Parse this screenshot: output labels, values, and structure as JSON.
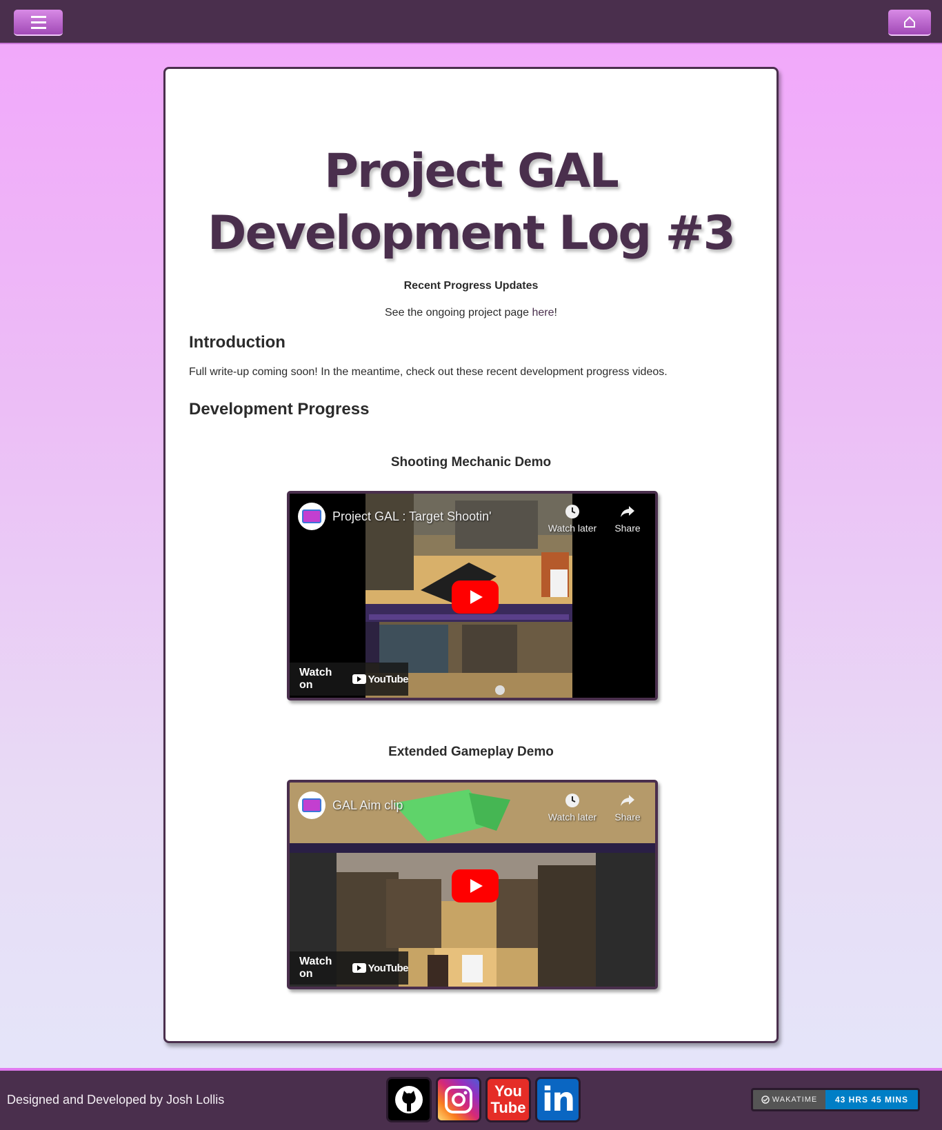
{
  "nav": {
    "menu_icon": "hamburger-menu-icon",
    "home_icon": "home-icon"
  },
  "article": {
    "title_line1": "Project GAL",
    "title_line2": "Development Log #3",
    "subtitle": "Recent Progress Updates",
    "project_link_prefix": "See the ongoing project page ",
    "project_link_text": "here",
    "project_link_suffix": "!",
    "intro_heading": "Introduction",
    "intro_text": "Full write-up coming soon! In the meantime, check out these recent development progress videos.",
    "dev_heading": "Development Progress"
  },
  "videos": [
    {
      "section_title": "Shooting Mechanic Demo",
      "video_title": "Project GAL : Target Shootin'",
      "watch_later": "Watch later",
      "share": "Share",
      "watch_on": "Watch on",
      "youtube": "YouTube"
    },
    {
      "section_title": "Extended Gameplay Demo",
      "video_title": "GAL Aim clip",
      "watch_later": "Watch later",
      "share": "Share",
      "watch_on": "Watch on",
      "youtube": "YouTube"
    }
  ],
  "footer": {
    "credits": "Designed and Developed by Josh Lollis",
    "social": [
      {
        "icon": "github-icon"
      },
      {
        "icon": "instagram-icon"
      },
      {
        "icon": "youtube-icon",
        "label_top": "You",
        "label_bottom": "Tube"
      },
      {
        "icon": "linkedin-icon",
        "label": "in"
      }
    ],
    "wakatime_label": "WAKATIME",
    "wakatime_value": "43 HRS 45 MINS"
  },
  "colors": {
    "header_bg": "#4a2f4d",
    "accent": "#c874d6",
    "title_color": "#4a2f4d",
    "youtube_red": "#ff0000"
  }
}
